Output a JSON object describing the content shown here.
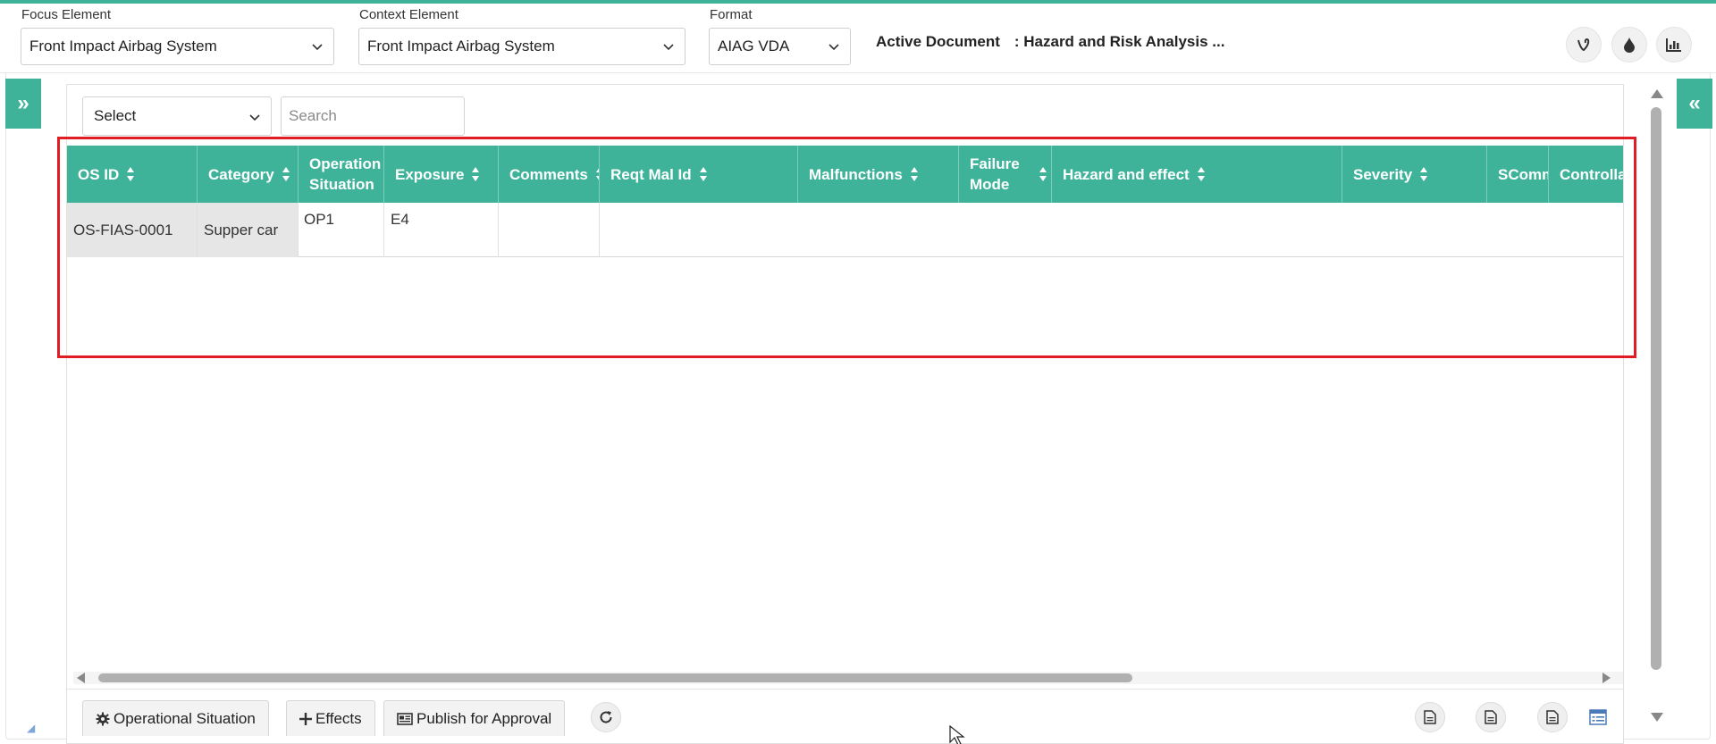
{
  "header": {
    "focus_label": "Focus Element",
    "focus_value": "Front Impact Airbag System",
    "context_label": "Context Element",
    "context_value": "Front Impact Airbag System",
    "format_label": "Format",
    "format_value": "AIAG VDA",
    "active_doc_label": "Active Document",
    "active_doc_value": ": Hazard and Risk Analysis ...",
    "icons": [
      "vine-icon",
      "drop-icon",
      "bar-chart-icon"
    ]
  },
  "toolbar": {
    "select_value": "Select",
    "search_placeholder": "Search"
  },
  "table": {
    "columns": [
      {
        "label": "OS ID",
        "sortable": true
      },
      {
        "label": "Category",
        "sortable": true
      },
      {
        "label": "Operation Situation",
        "line1": "Operation",
        "line2": "Situation",
        "sortable": false
      },
      {
        "label": "Exposure",
        "sortable": true
      },
      {
        "label": "Comments",
        "sortable": true
      },
      {
        "label": "Reqt Mal Id",
        "sortable": true
      },
      {
        "label": "Malfunctions",
        "sortable": true
      },
      {
        "label": "Failure Mode",
        "line1": "Failure",
        "line2": "Mode",
        "sortable": true
      },
      {
        "label": "Hazard and effect",
        "sortable": true
      },
      {
        "label": "Severity",
        "sortable": true
      },
      {
        "label": "SComm",
        "sortable": false
      },
      {
        "label": "Controlla",
        "sortable": false
      }
    ],
    "rows": [
      {
        "os_id": "OS-FIAS-0001",
        "category": "Supper car",
        "operation_situation": "OP1",
        "exposure": "E4",
        "comments": "",
        "reqt_mal_id": "",
        "malfunctions": "",
        "failure_mode": "",
        "hazard_and_effect": "",
        "severity": "",
        "scomm": "",
        "controlla": ""
      }
    ]
  },
  "bottom": {
    "operational_situation_label": "Operational Situation",
    "effects_label": "Effects",
    "publish_label": "Publish for Approval"
  },
  "colors": {
    "accent": "#3fb39a",
    "highlight": "#e01c24"
  }
}
